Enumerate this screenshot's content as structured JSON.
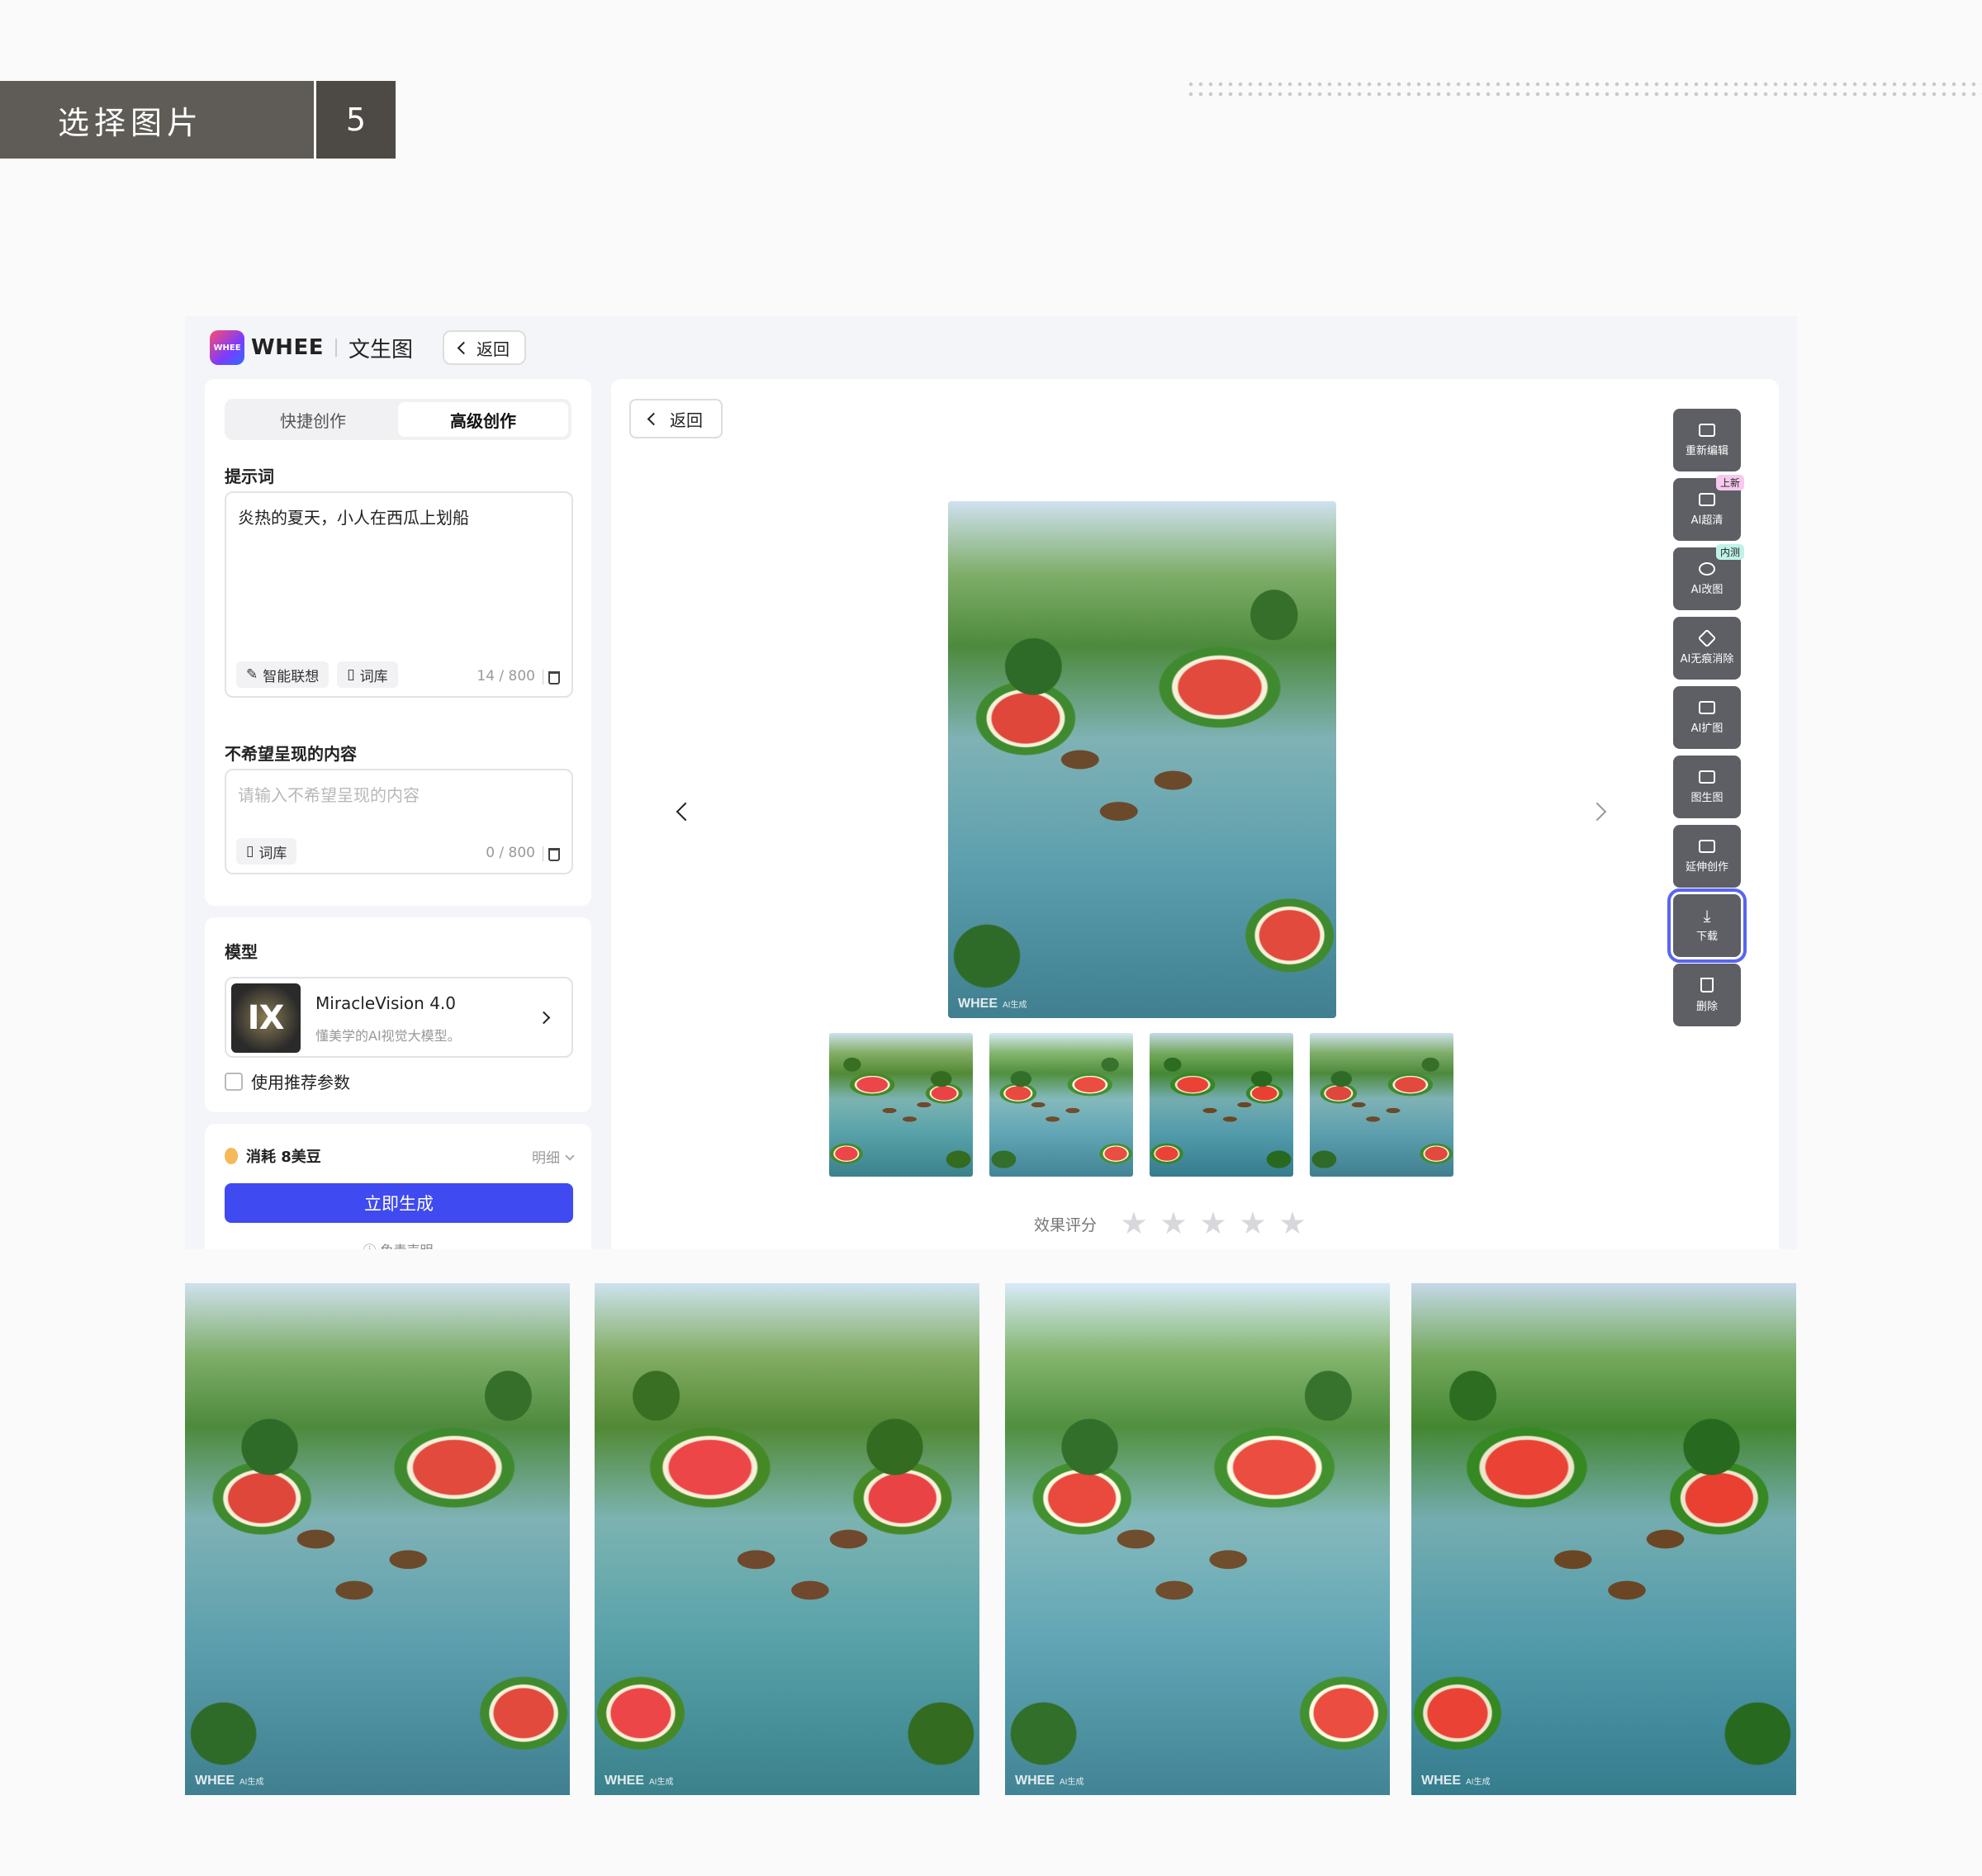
{
  "section": {
    "title": "选择图片",
    "number": "5"
  },
  "app": {
    "brand": "WHEE",
    "brand_badge": "WHEE",
    "app_name": "文生图",
    "back_label": "返回"
  },
  "left": {
    "tabs": [
      {
        "label": "快捷创作",
        "active": false
      },
      {
        "label": "高级创作",
        "active": true
      }
    ],
    "prompt": {
      "label": "提示词",
      "value": "炎热的夏天，小人在西瓜上划船",
      "chip_assoc": "智能联想",
      "chip_lib": "词库",
      "counter": "14 / 800"
    },
    "negative": {
      "label": "不希望呈现的内容",
      "placeholder": "请输入不希望呈现的内容",
      "chip_lib": "词库",
      "counter": "0 / 800"
    },
    "model": {
      "label": "模型",
      "name": "MiracleVision 4.0",
      "desc": "懂美学的AI视觉大模型。",
      "thumb_glyph": "Ⅸ"
    },
    "use_recommended": "使用推荐参数",
    "cost": "消耗 8美豆",
    "detail": "明细",
    "generate": "立即生成",
    "disclaimer": "ⓘ 免责声明"
  },
  "main": {
    "back_label": "返回",
    "watermark": "WHEE",
    "watermark_sub": "AI生成",
    "rating_label": "效果评分",
    "rating_stars": 5,
    "tools": [
      {
        "label": "重新编辑",
        "icon": "edit-image-icon",
        "badge": ""
      },
      {
        "label": "AI超清",
        "icon": "hd-icon",
        "badge": "上新"
      },
      {
        "label": "AI改图",
        "icon": "brush-icon",
        "badge": "内测"
      },
      {
        "label": "AI无痕消除",
        "icon": "eraser-icon",
        "badge": ""
      },
      {
        "label": "AI扩图",
        "icon": "expand-icon",
        "badge": ""
      },
      {
        "label": "图生图",
        "icon": "image-to-image-icon",
        "badge": ""
      },
      {
        "label": "延伸创作",
        "icon": "extend-icon",
        "badge": ""
      },
      {
        "label": "下载",
        "icon": "download-icon",
        "badge": "",
        "selected": true
      },
      {
        "label": "删除",
        "icon": "trash-icon",
        "badge": ""
      }
    ]
  },
  "colors": {
    "primary": "#3f4af0",
    "header_bg": "#5f5c57",
    "tool_bg": "#5e5f65",
    "select_ring": "#5865f2"
  }
}
